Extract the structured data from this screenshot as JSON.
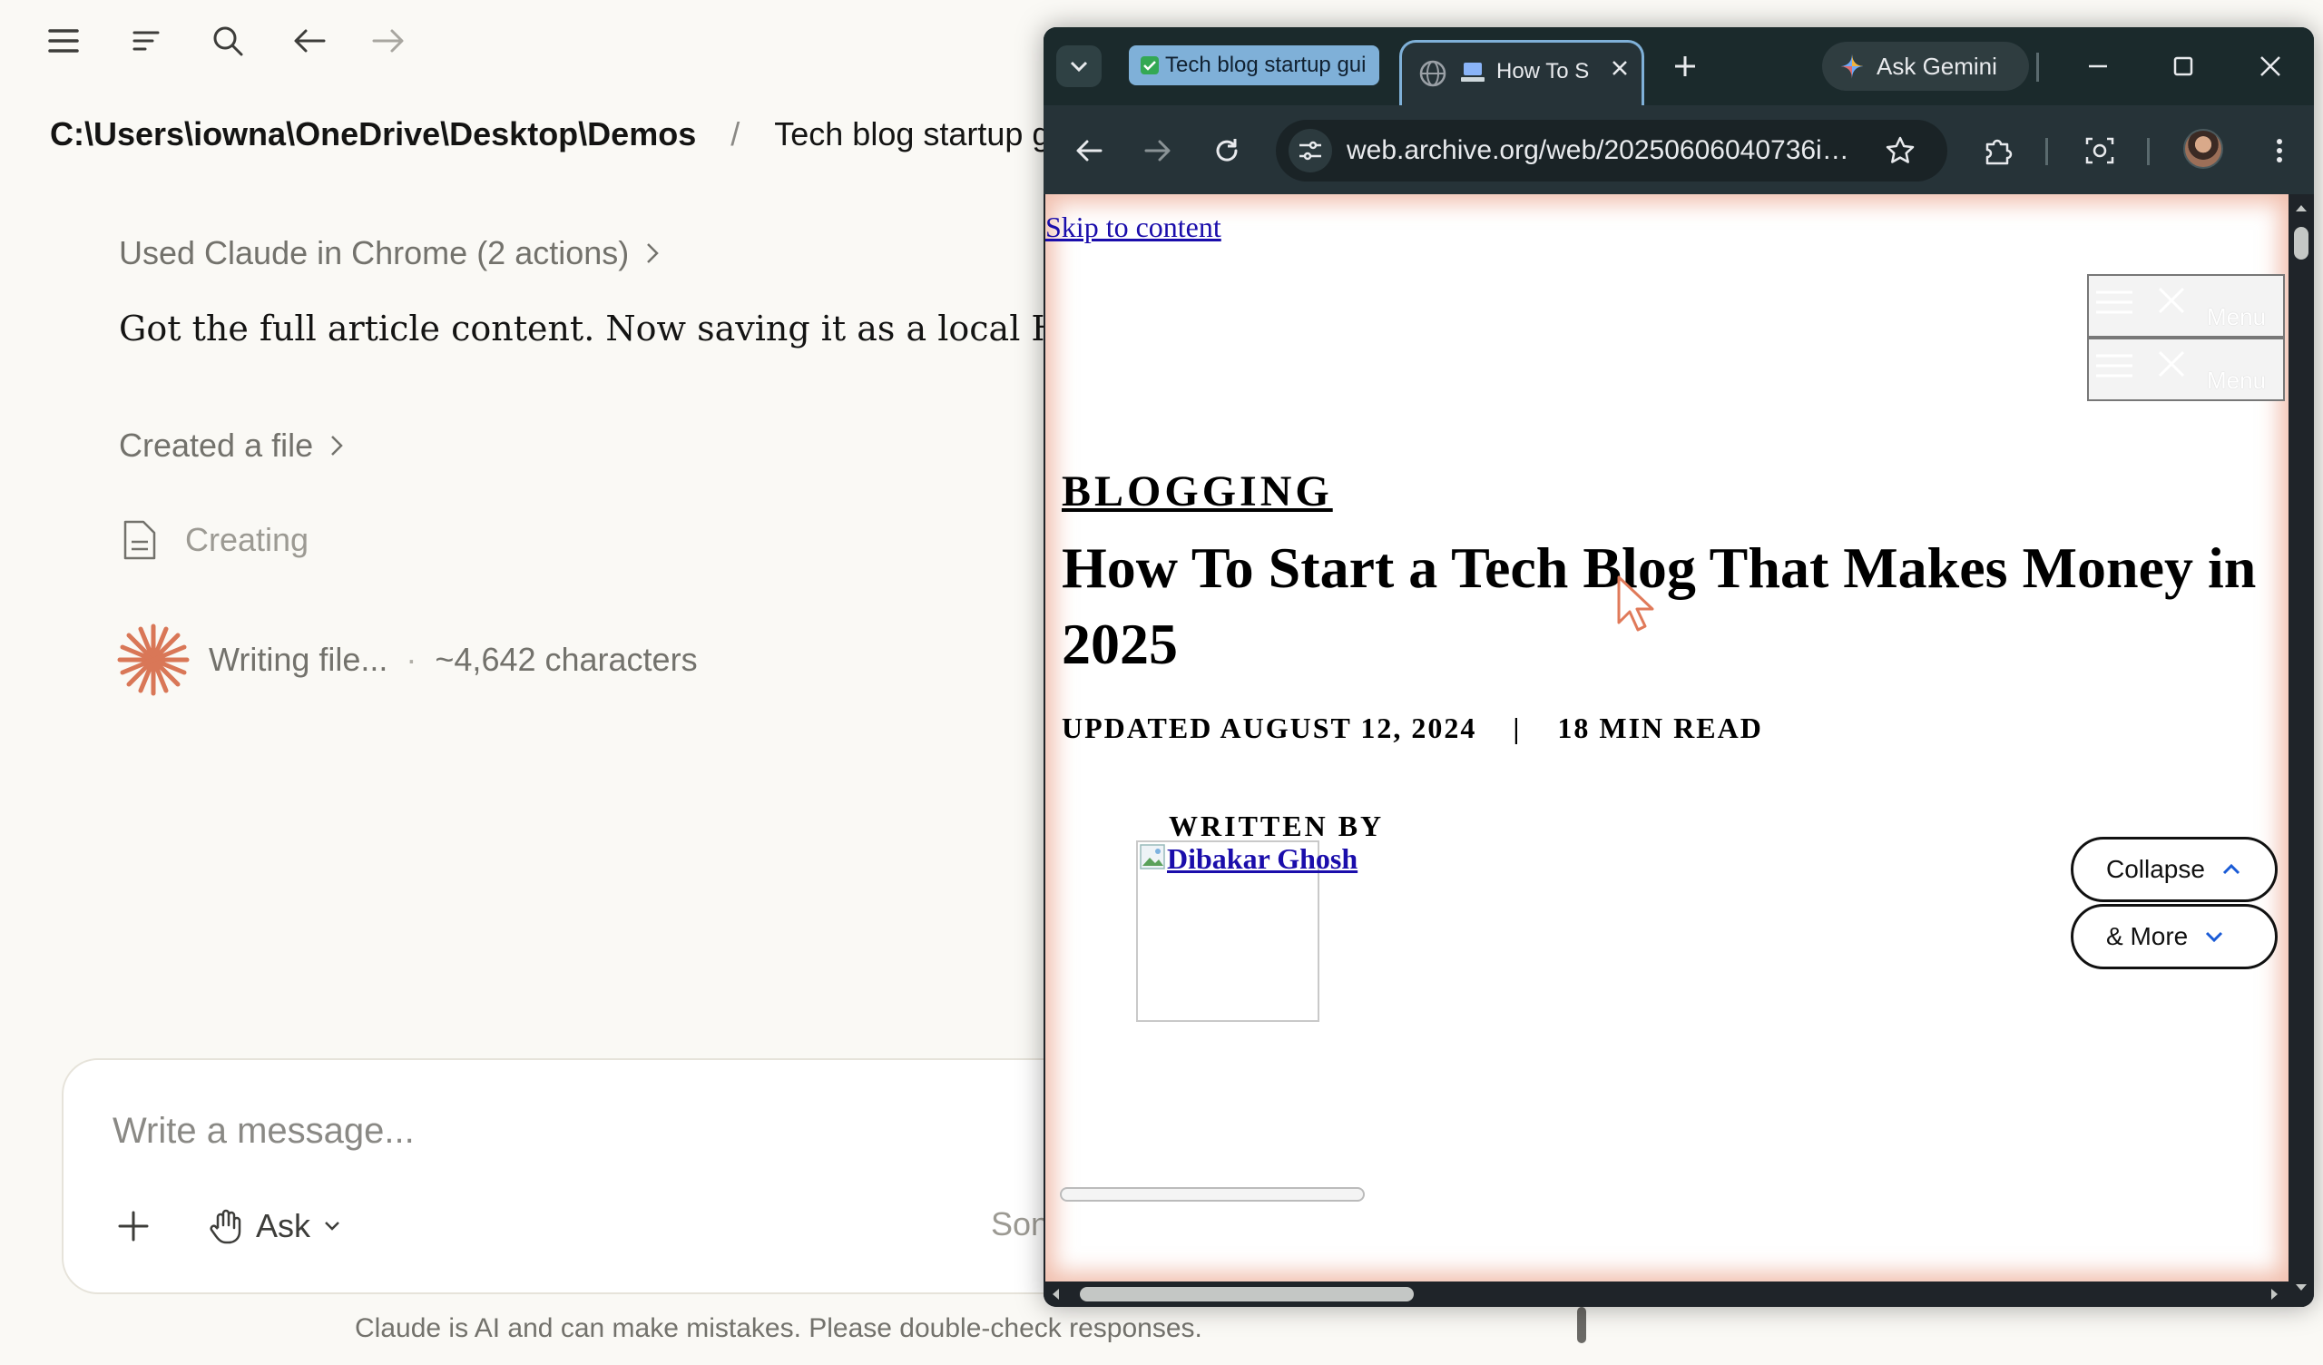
{
  "claude": {
    "breadcrumb": {
      "path": "C:\\Users\\iowna\\OneDrive\\Desktop\\Demos",
      "separator": "/",
      "project": "Tech blog startup g"
    },
    "steps": {
      "used_chrome": "Used Claude in Chrome (2 actions)",
      "message": "Got the full article content. Now saving it as a local HTM",
      "created_file": "Created a file",
      "creating": "Creating",
      "writing": "Writing file...",
      "dot": "·",
      "char_count": "~4,642 characters"
    },
    "composer": {
      "placeholder": "Write a message...",
      "mode_label": "Ask",
      "model_partial": "Son"
    },
    "disclaimer": "Claude is AI and can make mistakes. Please double-check responses.",
    "accent_color": "#d97757"
  },
  "browser": {
    "tab_group_label": "Tech blog startup gui",
    "active_tab_title": "How To S",
    "gemini_label": "Ask Gemini",
    "url": "web.archive.org/web/20250606040736id_...",
    "page": {
      "skip_link": "Skip to content",
      "menu_label": "Menu",
      "category": "BLOGGING",
      "title": "How To Start a Tech Blog That Makes Money in 2025",
      "updated": "UPDATED AUGUST 12, 2024",
      "meta_sep": "|",
      "read_time": "18 MIN READ",
      "written_by": "WRITTEN BY",
      "author": "Dibakar Ghosh",
      "collapse_label": "Collapse",
      "more_label": "& More"
    }
  }
}
